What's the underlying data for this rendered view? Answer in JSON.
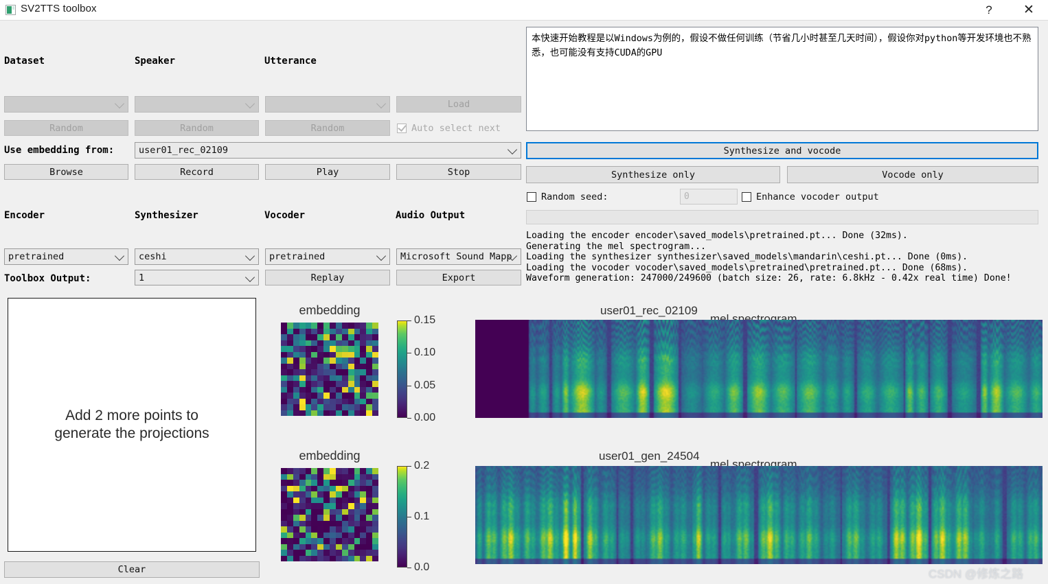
{
  "window": {
    "title": "SV2TTS toolbox",
    "help_label": "?",
    "close_label": "✕"
  },
  "selection": {
    "dataset_label": "Dataset",
    "speaker_label": "Speaker",
    "utterance_label": "Utterance",
    "dataset_value": "",
    "speaker_value": "",
    "utterance_value": "",
    "load_label": "Load",
    "random_dataset_label": "Random",
    "random_speaker_label": "Random",
    "random_utterance_label": "Random",
    "auto_select_label": "Auto select next",
    "auto_select_checked": true,
    "use_embedding_label": "Use embedding from:",
    "use_embedding_value": "user01_rec_02109",
    "browse_label": "Browse",
    "record_label": "Record",
    "play_label": "Play",
    "stop_label": "Stop"
  },
  "models": {
    "encoder_label": "Encoder",
    "synthesizer_label": "Synthesizer",
    "vocoder_label": "Vocoder",
    "audio_output_label": "Audio Output",
    "encoder_value": "pretrained",
    "synthesizer_value": "ceshi",
    "vocoder_value": "pretrained",
    "audio_output_value": "Microsoft Sound Mapp",
    "toolbox_output_label": "Toolbox Output:",
    "toolbox_output_value": "1",
    "replay_label": "Replay",
    "export_label": "Export"
  },
  "synthesis": {
    "text_value": "本快速开始教程是以Windows为例的，假设不做任何训练（节省几小时甚至几天时间），假设你对python等开发环境也不熟悉，也可能没有支持CUDA的GPU",
    "synthesize_and_vocode_label": "Synthesize and vocode",
    "synthesize_only_label": "Synthesize only",
    "vocode_only_label": "Vocode only",
    "random_seed_label": "Random seed:",
    "random_seed_checked": false,
    "seed_value": "0",
    "enhance_label": "Enhance vocoder output",
    "enhance_checked": false
  },
  "console": {
    "lines": [
      "Loading the encoder encoder\\saved_models\\pretrained.pt... Done (32ms).",
      "Generating the mel spectrogram...",
      "Loading the synthesizer synthesizer\\saved_models\\mandarin\\ceshi.pt... Done (0ms).",
      "Loading the vocoder vocoder\\saved_models\\pretrained\\pretrained.pt... Done (68ms).",
      "Waveform generation: 247000/249600 (batch size: 26, rate: 6.8kHz - 0.42x real time) Done!"
    ]
  },
  "projection": {
    "message": "Add 2 more points to\ngenerate the projections",
    "clear_label": "Clear"
  },
  "chart_data": [
    {
      "type": "heatmap",
      "title": "embedding",
      "rows": 16,
      "cols": 16,
      "colormap": "viridis",
      "colorbar_ticks": [
        "0.00",
        "0.05",
        "0.10",
        "0.15"
      ],
      "vmin": 0.0,
      "vmax": 0.18,
      "seed": 11
    },
    {
      "type": "heatmap",
      "title": "embedding",
      "rows": 16,
      "cols": 16,
      "colormap": "viridis",
      "colorbar_ticks": [
        "0.0",
        "0.1",
        "0.2"
      ],
      "vmin": 0.0,
      "vmax": 0.27,
      "seed": 37
    },
    {
      "type": "heatmap",
      "title": "user01_rec_02109",
      "subtitle": "mel spectrogram",
      "colormap": "viridis",
      "silence_fraction": 0.095,
      "style": "recorded",
      "seed": 5
    },
    {
      "type": "heatmap",
      "title": "user01_gen_24504",
      "subtitle": "mel spectrogram",
      "colormap": "viridis",
      "silence_fraction": 0.0,
      "style": "generated",
      "seed": 9
    }
  ],
  "watermark": "CSDN @修炼之路"
}
